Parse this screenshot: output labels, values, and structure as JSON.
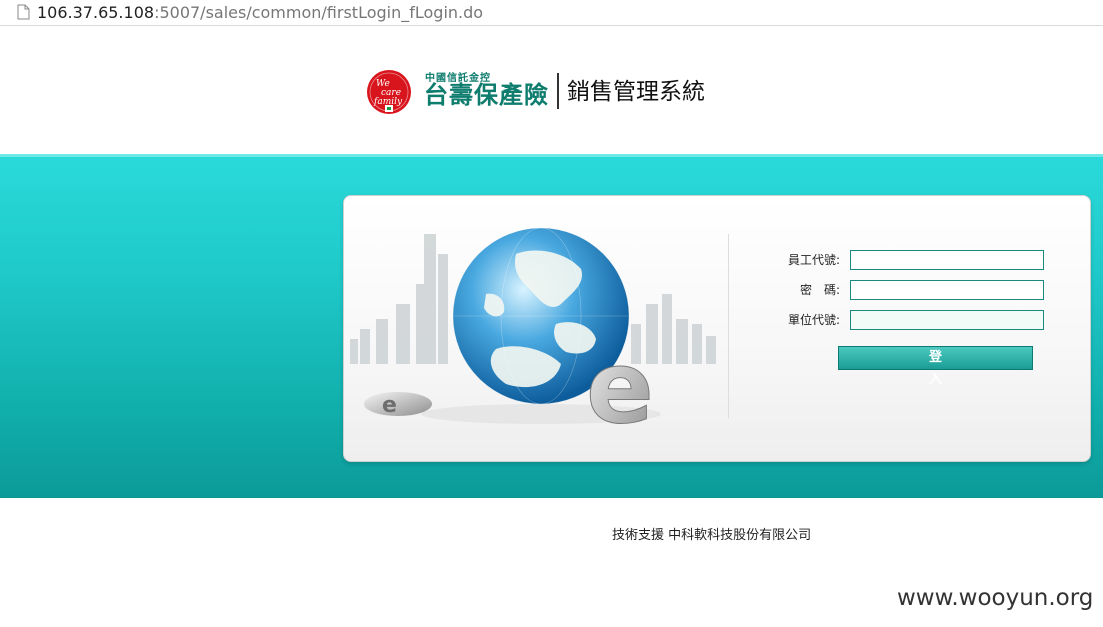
{
  "browser": {
    "url_host": "106.37.65.108",
    "url_path": ":5007/sales/common/firstLogin_fLogin.do",
    "page_icon": "document-icon"
  },
  "header": {
    "logo_icon": "we-care-family-logo",
    "logo_badge_text": "We care family",
    "logo_small_text": "中國信託金控",
    "logo_main_text": "台壽保產險",
    "system_title": "銷售管理系統"
  },
  "colors": {
    "brand_green": "#0f7d6e",
    "band_teal": "#1fc9c9",
    "button_teal": "#1a9c94",
    "logo_red": "#d8141c"
  },
  "login": {
    "illustration": "globe-city-e-illustration",
    "employee_id_label": "員工代號:",
    "employee_id_value": "",
    "password_label": "密　碼:",
    "password_value": "",
    "unit_id_label": "單位代號:",
    "unit_id_value": "",
    "login_button_label": "登入"
  },
  "footer": {
    "support_text": "技術支援 中科軟科技股份有限公司"
  },
  "watermark": "www.wooyun.org"
}
